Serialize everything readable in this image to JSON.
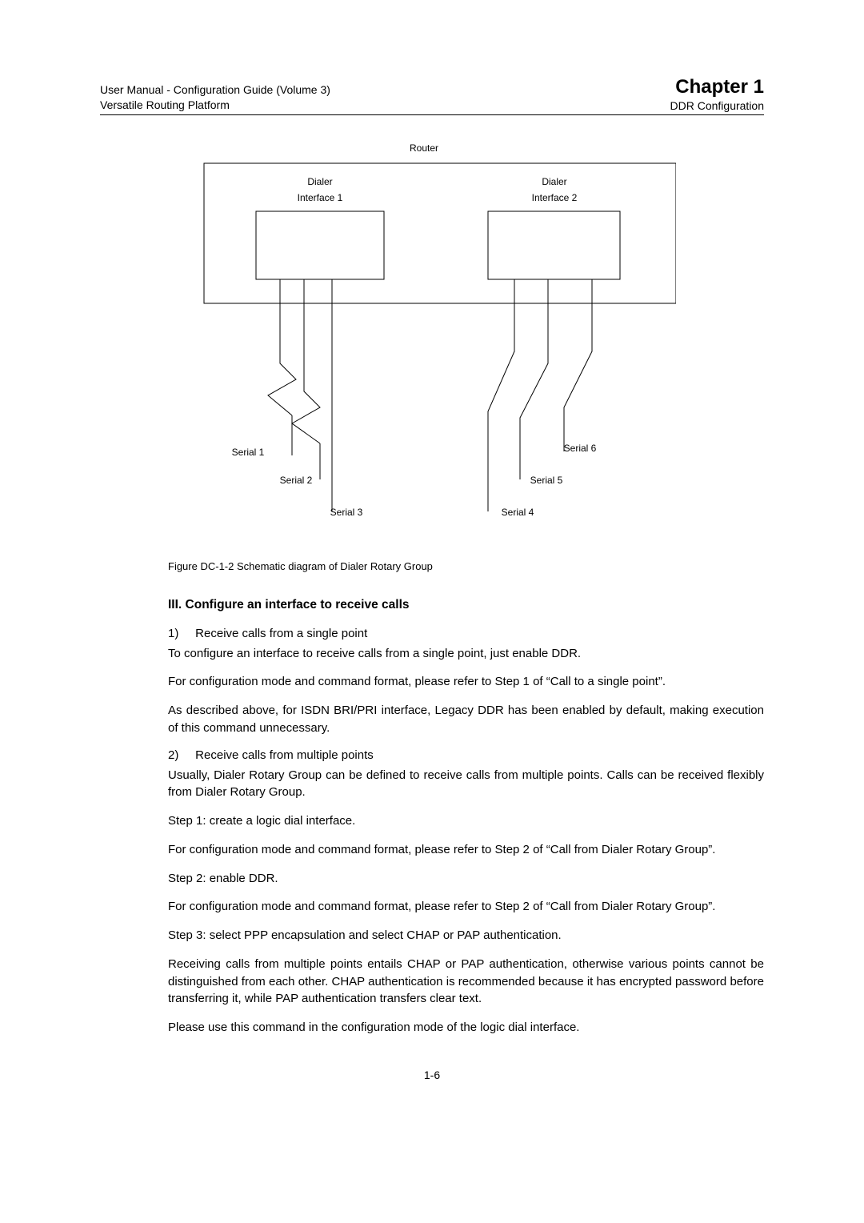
{
  "header": {
    "left_line1": "User Manual - Configuration Guide (Volume 3)",
    "left_line2": "Versatile Routing Platform",
    "chapter_title": "Chapter 1",
    "chapter_sub": "DDR Configuration"
  },
  "diagram": {
    "router": "Router",
    "dialer1_line1": "Dialer",
    "dialer1_line2": "Interface 1",
    "dialer2_line1": "Dialer",
    "dialer2_line2": "Interface 2",
    "serial1": "Serial 1",
    "serial2": "Serial 2",
    "serial3": "Serial 3",
    "serial4": "Serial 4",
    "serial5": "Serial 5",
    "serial6": "Serial 6"
  },
  "figure": {
    "number": "Figure DC-1-2",
    "caption": "  Schematic diagram of Dialer Rotary Group"
  },
  "section_heading": "III. Configure an interface to receive calls",
  "list": {
    "item1_num": "1)",
    "item1_text": "Receive calls from a single point",
    "item2_num": "2)",
    "item2_text": "Receive calls from multiple points"
  },
  "paragraphs": {
    "p1": "To configure an interface to receive calls from a single point, just enable DDR.",
    "p2": "For configuration mode and command format, please refer to Step 1 of “Call to a single point”.",
    "p3": "As described above, for ISDN BRI/PRI interface, Legacy DDR has been enabled by default, making execution of this command unnecessary.",
    "p4": "Usually, Dialer Rotary Group can be defined to receive calls from multiple points. Calls can be received flexibly from Dialer Rotary Group.",
    "p5": "Step 1: create a logic dial interface.",
    "p6": "For configuration mode and command format, please refer to Step 2 of “Call from Dialer Rotary Group”.",
    "p7": "Step 2: enable DDR.",
    "p8": "For configuration mode and command format, please refer to Step 2 of “Call from Dialer Rotary Group”.",
    "p9": "Step 3: select PPP encapsulation and select CHAP or PAP authentication.",
    "p10": "Receiving calls from multiple points entails CHAP or PAP authentication, otherwise various points cannot be distinguished from each other. CHAP authentication is recommended because it has encrypted password before transferring it, while PAP authentication transfers clear text.",
    "p11": "Please use this command in the configuration mode of the logic dial interface."
  },
  "page_number": "1-6"
}
